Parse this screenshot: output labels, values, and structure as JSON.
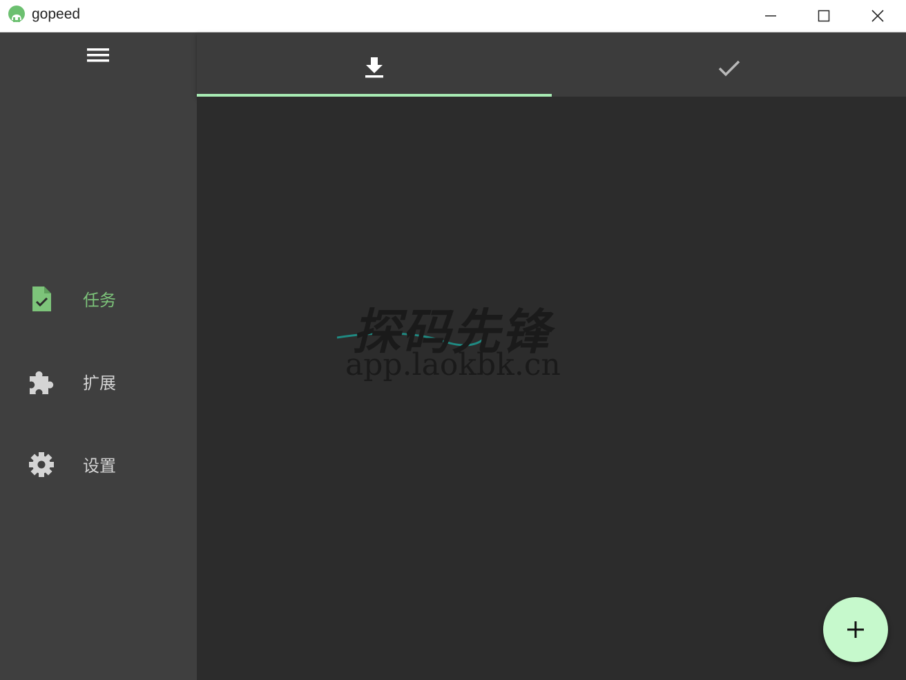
{
  "window": {
    "title": "gopeed",
    "controls": {
      "minimize": "minimize-icon",
      "maximize": "maximize-icon",
      "close": "close-icon"
    }
  },
  "sidebar": {
    "menu_icon": "menu-icon",
    "items": [
      {
        "label": "任务",
        "icon": "task-file-check-icon",
        "active": true
      },
      {
        "label": "扩展",
        "icon": "puzzle-icon",
        "active": false
      },
      {
        "label": "设置",
        "icon": "gear-icon",
        "active": false
      }
    ]
  },
  "tabs": [
    {
      "icon": "download-icon",
      "active": true
    },
    {
      "icon": "check-icon",
      "active": false
    }
  ],
  "watermark": {
    "brand": "探码先锋",
    "url": "app.laokbk.cn"
  },
  "fab": {
    "icon": "plus-icon"
  },
  "colors": {
    "accent": "#7dc47a",
    "tab_indicator": "#a8ecb4",
    "fab": "#c6f9cc",
    "sidebar": "#3f3f3f",
    "content": "#2c2c2c",
    "tabbar": "#3c3c3c"
  }
}
